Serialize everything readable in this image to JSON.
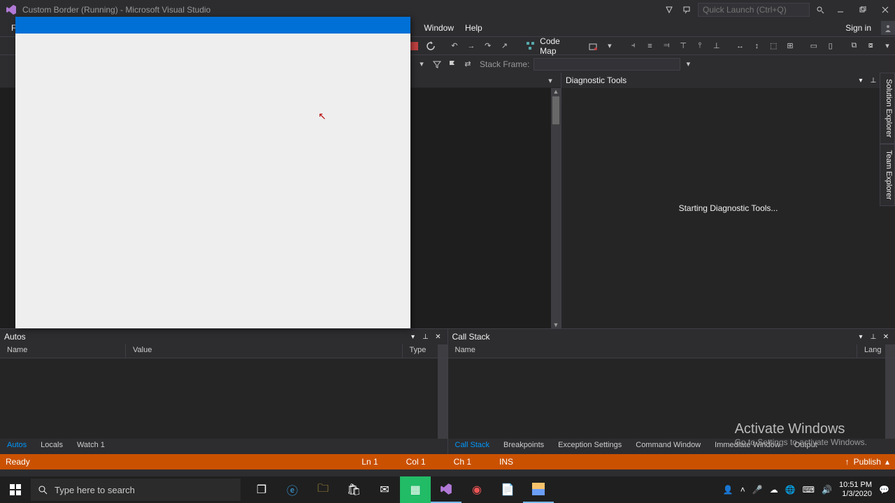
{
  "title": "Custom Border (Running) - Microsoft Visual Studio",
  "quickLaunch": {
    "placeholder": "Quick Launch (Ctrl+Q)"
  },
  "menus": {
    "file": "File",
    "window": "Window",
    "help": "Help",
    "signin": "Sign in"
  },
  "toolbar": {
    "codeMap": "Code Map",
    "stackFrameLabel": "Stack Frame:"
  },
  "sidebar": {
    "solutionExplorer": "Solution Explorer",
    "teamExplorer": "Team Explorer"
  },
  "diag": {
    "title": "Diagnostic Tools",
    "msg": "Starting Diagnostic Tools..."
  },
  "autos": {
    "title": "Autos",
    "cols": {
      "name": "Name",
      "value": "Value",
      "type": "Type"
    },
    "tabs": {
      "autos": "Autos",
      "locals": "Locals",
      "watch1": "Watch 1"
    }
  },
  "callstack": {
    "title": "Call Stack",
    "cols": {
      "name": "Name",
      "lang": "Lang"
    },
    "tabs": {
      "callstack": "Call Stack",
      "breakpoints": "Breakpoints",
      "exception": "Exception Settings",
      "command": "Command Window",
      "immediate": "Immediate Window",
      "output": "Output"
    }
  },
  "status": {
    "ready": "Ready",
    "ln": "Ln 1",
    "col": "Col 1",
    "ch": "Ch 1",
    "ins": "INS",
    "publish": "Publish"
  },
  "watermark": {
    "title": "Activate Windows",
    "sub": "Go to Settings to activate Windows."
  },
  "taskbar": {
    "search": "Type here to search",
    "time": "10:51 PM",
    "date": "1/3/2020"
  }
}
